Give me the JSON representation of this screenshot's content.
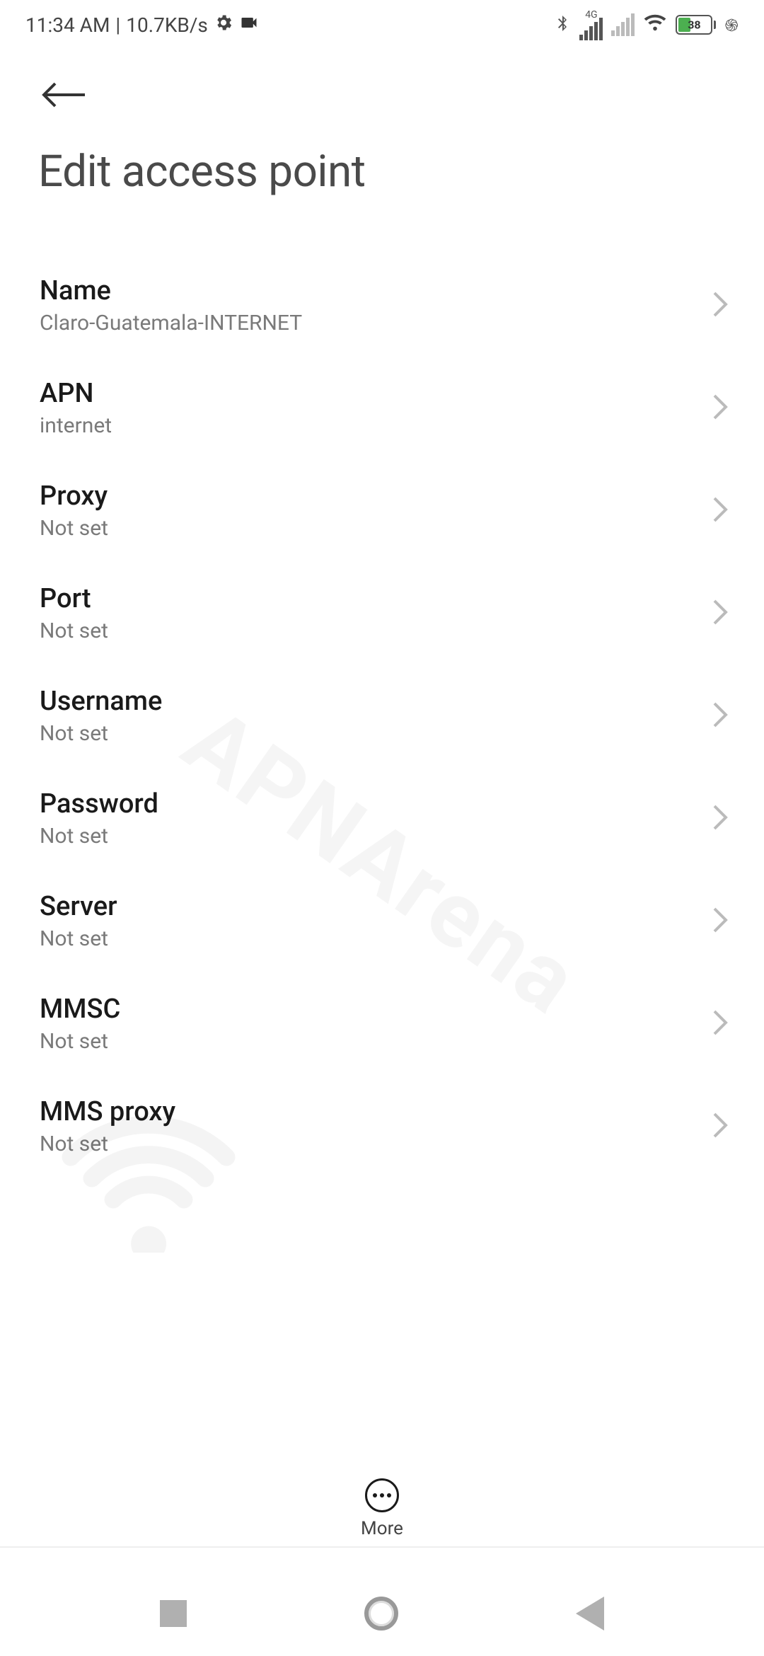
{
  "status_bar": {
    "time": "11:34 AM",
    "separator": "|",
    "data_rate": "10.7KB/s",
    "network_type": "4G",
    "battery_percent": "38"
  },
  "header": {
    "title": "Edit access point"
  },
  "settings": [
    {
      "label": "Name",
      "value": "Claro-Guatemala-INTERNET"
    },
    {
      "label": "APN",
      "value": "internet"
    },
    {
      "label": "Proxy",
      "value": "Not set"
    },
    {
      "label": "Port",
      "value": "Not set"
    },
    {
      "label": "Username",
      "value": "Not set"
    },
    {
      "label": "Password",
      "value": "Not set"
    },
    {
      "label": "Server",
      "value": "Not set"
    },
    {
      "label": "MMSC",
      "value": "Not set"
    },
    {
      "label": "MMS proxy",
      "value": "Not set"
    }
  ],
  "bottom_action": {
    "label": "More"
  },
  "watermark": "APNArena"
}
